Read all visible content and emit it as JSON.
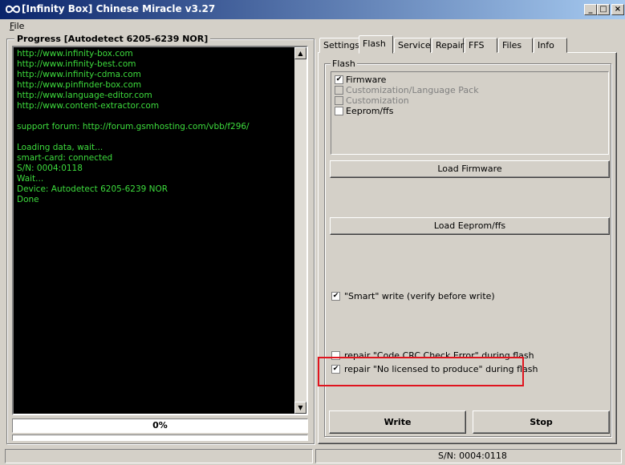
{
  "window": {
    "title": "[Infinity Box] Chinese Miracle v3.27",
    "icons": {
      "app": "infinity-icon",
      "minimize": "minimize-icon",
      "maximize": "maximize-icon",
      "close": "close-icon"
    },
    "glyphs": {
      "minimize": "_",
      "maximize": "□",
      "close": "×"
    }
  },
  "menu": {
    "file_initial": "F",
    "file_rest": "ile"
  },
  "progress": {
    "title": "Progress [Autodetect 6205-6239 NOR]",
    "log_lines": [
      "http://www.infinity-box.com",
      "http://www.infinity-best.com",
      "http://www.infinity-cdma.com",
      "http://www.pinfinder-box.com",
      "http://www.language-editor.com",
      "http://www.content-extractor.com",
      "",
      "support forum: http://forum.gsmhosting.com/vbb/f296/",
      "",
      "Loading data, wait...",
      "smart-card: connected",
      "S/N: 0004:0118",
      "Wait...",
      "Device: Autodetect 6205-6239 NOR",
      "Done"
    ],
    "percent": "0%",
    "scroll_up_glyph": "▲",
    "scroll_down_glyph": "▼"
  },
  "tabs": [
    {
      "label": "Settings",
      "active": false
    },
    {
      "label": "Flash",
      "active": true
    },
    {
      "label": "Service",
      "active": false
    },
    {
      "label": "Repair",
      "active": false
    },
    {
      "label": "FFS",
      "active": false
    },
    {
      "label": "Files",
      "active": false
    },
    {
      "label": "Info",
      "active": false
    }
  ],
  "flash": {
    "group_title": "Flash",
    "items": [
      {
        "label": "Firmware",
        "checked": true,
        "enabled": true
      },
      {
        "label": "Customization/Language Pack",
        "checked": false,
        "enabled": false
      },
      {
        "label": "Customization",
        "checked": false,
        "enabled": false
      },
      {
        "label": "Eeprom/ffs",
        "checked": false,
        "enabled": true
      }
    ],
    "load_firmware": "Load Firmware",
    "load_eeprom": "Load Eeprom/ffs",
    "smart_write": {
      "label": "\"Smart\" write (verify before write)",
      "checked": true
    },
    "repair_crc": {
      "label": "repair \"Code CRC Check Error\" during flash",
      "checked": false
    },
    "repair_nolicense": {
      "label": "repair \"No licensed to produce\" during flash",
      "checked": true
    },
    "check_glyph": "✔",
    "write_button": "Write",
    "stop_button": "Stop"
  },
  "statusbar": {
    "left": "",
    "right": "S/N: 0004:0118"
  },
  "colors": {
    "log_text": "#3ddc3d",
    "highlight": "#e0141e",
    "titlebar_start": "#0a246a",
    "titlebar_end": "#a6caf0"
  }
}
